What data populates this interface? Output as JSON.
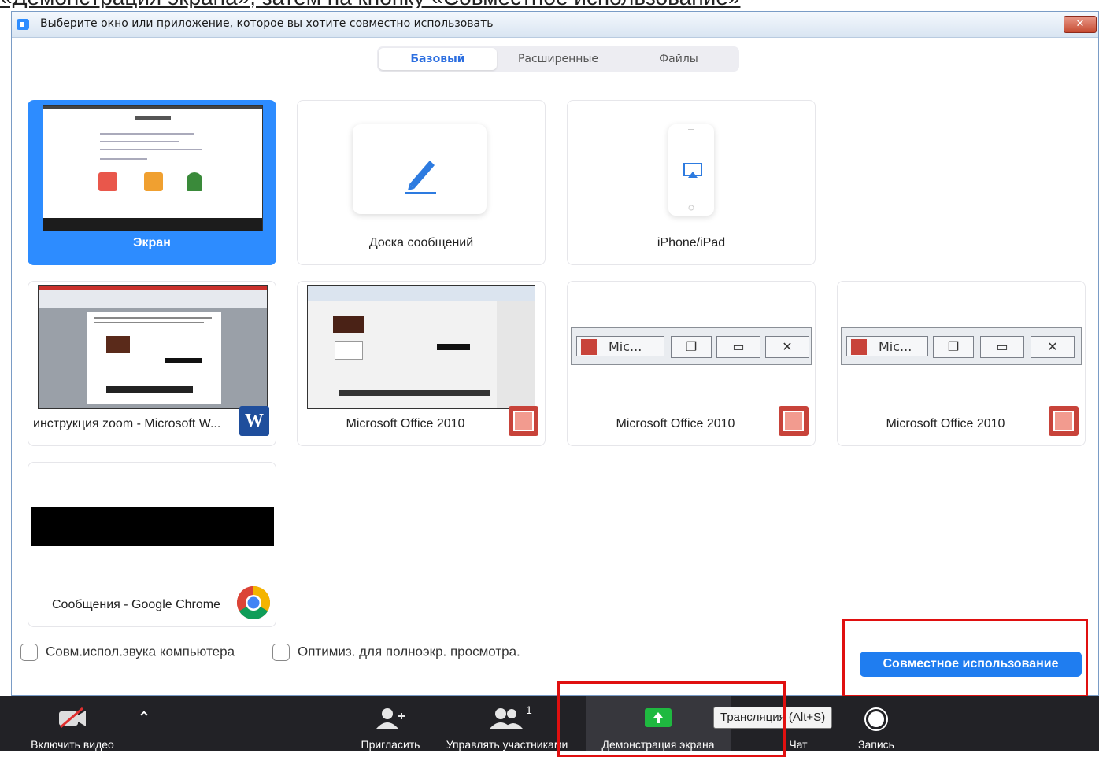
{
  "caption": "«Демонстрация экрана», затем на кнопку «Совместное использование»",
  "window": {
    "title": "Выберите окно или приложение, которое вы хотите совместно использовать",
    "close_label": "✕"
  },
  "tabs": [
    {
      "label": "Базовый",
      "active": true
    },
    {
      "label": "Расширенные",
      "active": false
    },
    {
      "label": "Файлы",
      "active": false
    }
  ],
  "cards": [
    {
      "label": "Экран",
      "selected": true
    },
    {
      "label": "Доска сообщений"
    },
    {
      "label": "iPhone/iPad"
    },
    {
      "label": "инструкция zoom - Microsoft W...",
      "app_icon": "word-icon",
      "icon_text": "W"
    },
    {
      "label": "Microsoft Office 2010",
      "app_icon": "powerpoint-icon"
    },
    {
      "label": "Microsoft Office 2010",
      "app_icon": "powerpoint-icon",
      "mini_title": "Mic..."
    },
    {
      "label": "Microsoft Office 2010",
      "app_icon": "powerpoint-icon",
      "mini_title": "Mic..."
    },
    {
      "label": "Сообщения - Google Chrome",
      "app_icon": "chrome-icon"
    }
  ],
  "options": {
    "share_audio": "Совм.испол.звука компьютера",
    "optimize": "Оптимиз. для полноэкр. просмотра."
  },
  "share_button": "Совместное использование",
  "toolbar": {
    "video": "Включить видео",
    "invite": "Пригласить",
    "participants": "Управлять участниками",
    "participants_count": "1",
    "share_screen": "Демонстрация экрана",
    "chat": "Чат",
    "record": "Запись"
  },
  "tooltip": "Трансляция (Alt+S)",
  "colors": {
    "accent": "#2d8cff",
    "highlight": "#e01010",
    "toolbar": "#222226"
  }
}
